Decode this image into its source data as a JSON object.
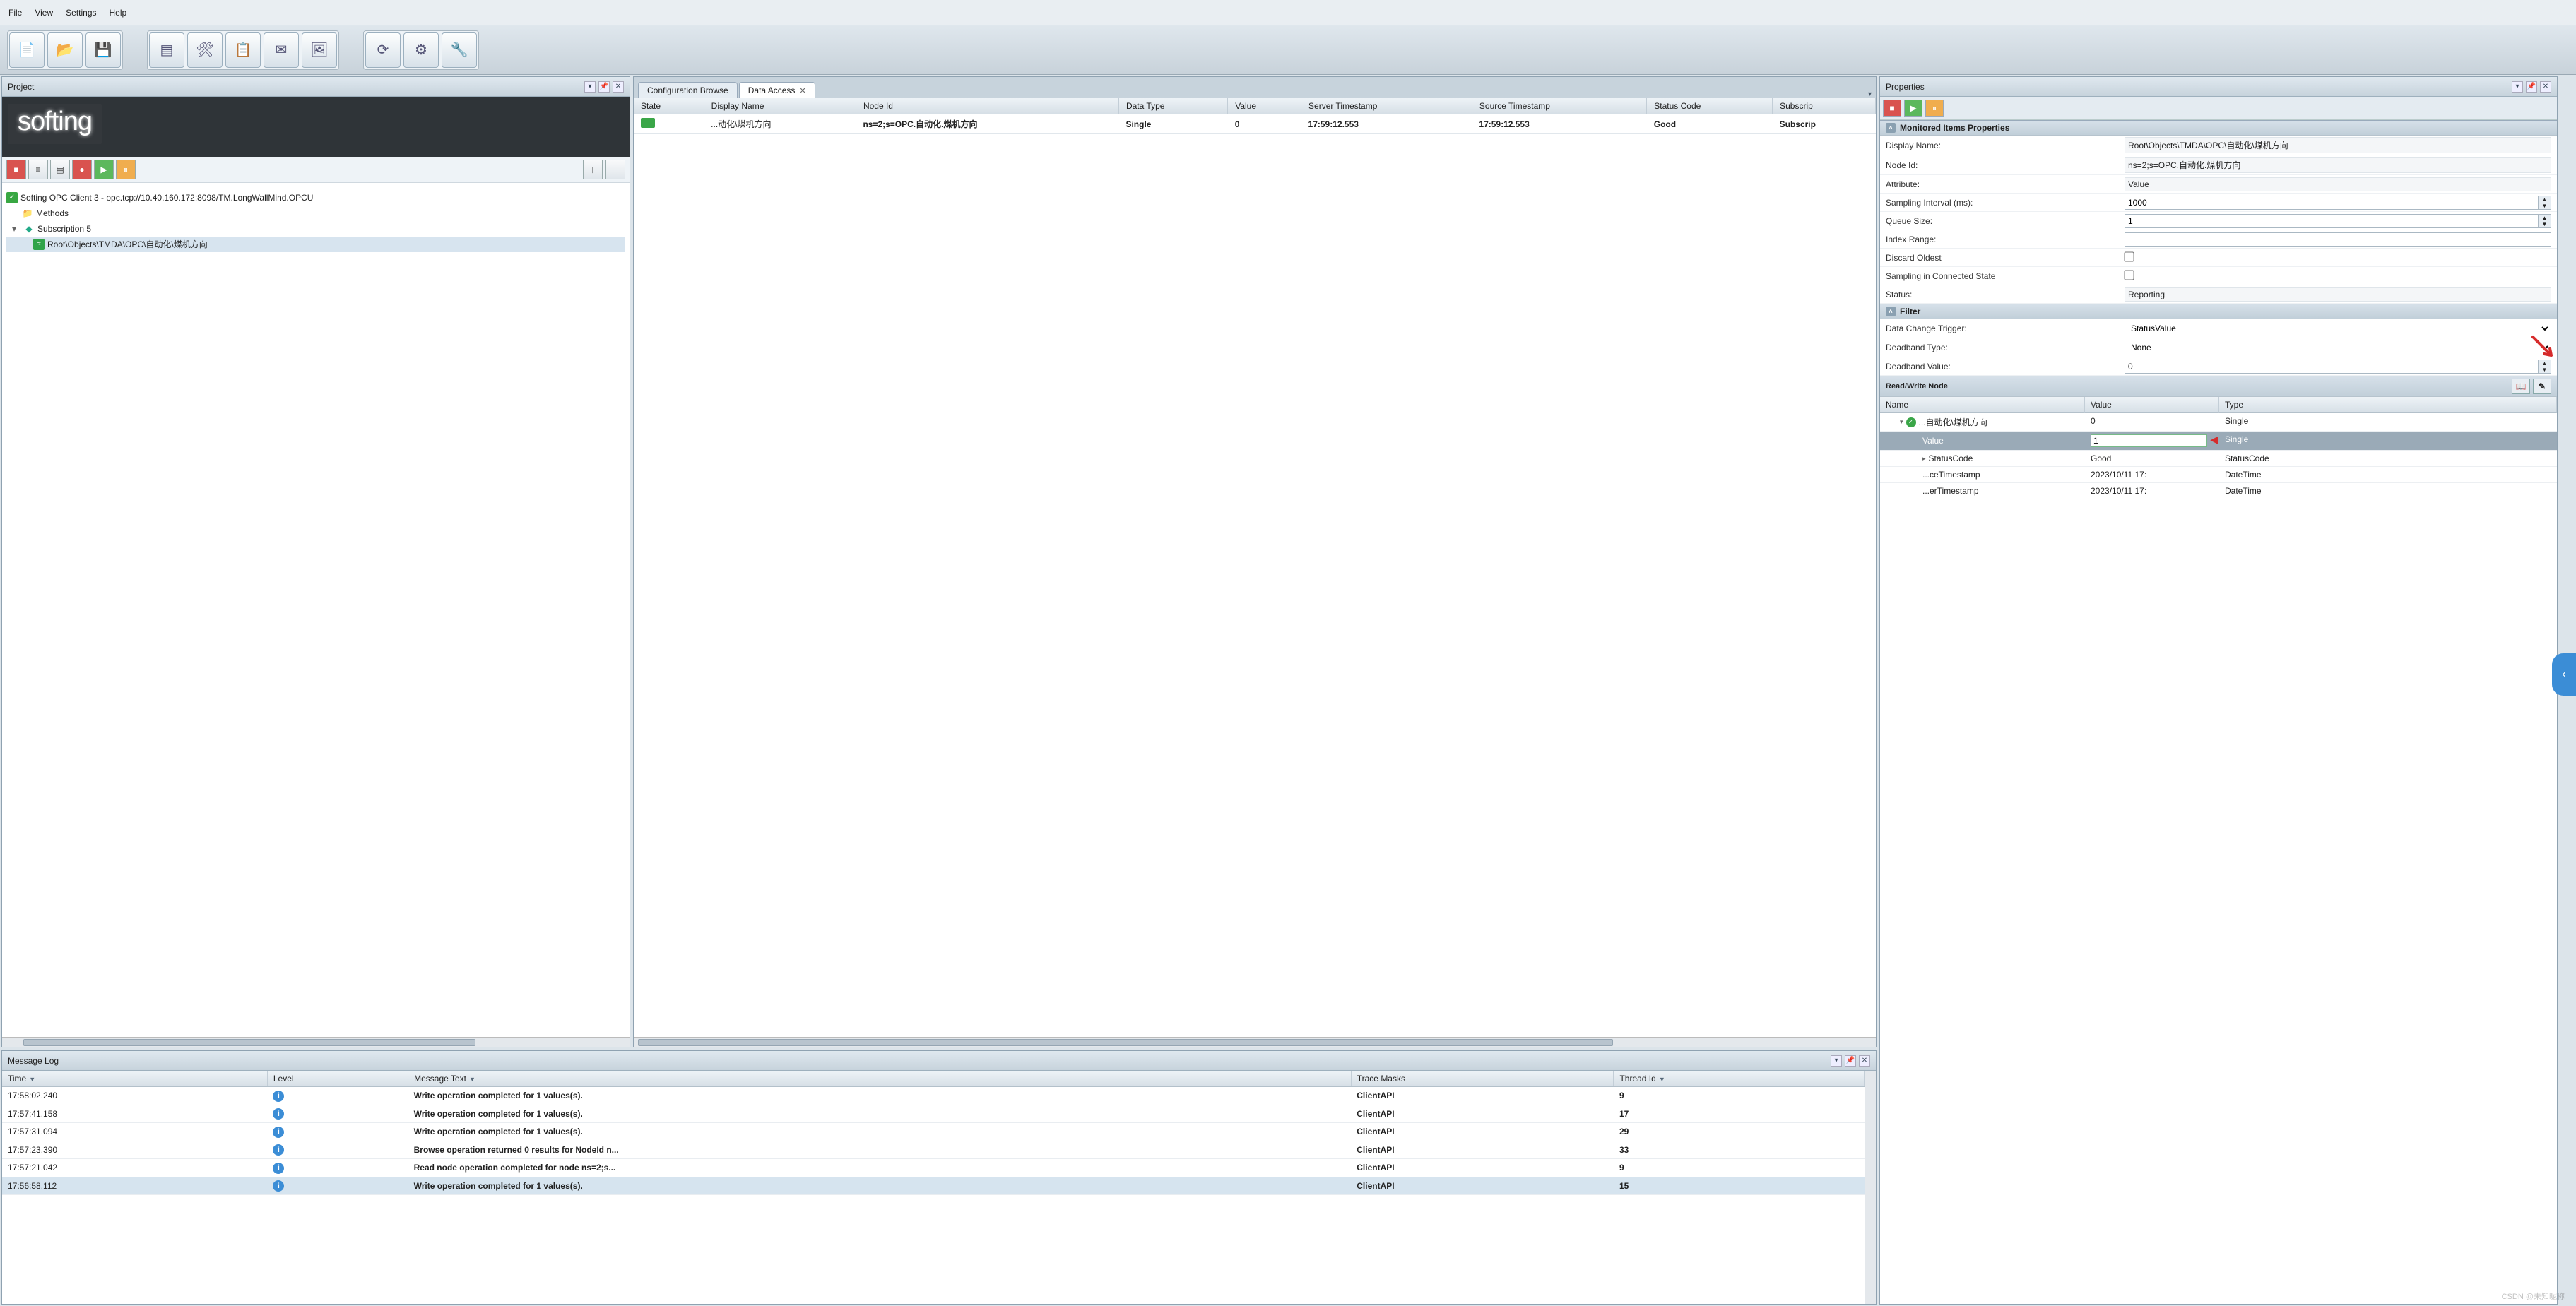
{
  "menu": {
    "file": "File",
    "view": "View",
    "settings": "Settings",
    "help": "Help"
  },
  "project": {
    "title": "Project",
    "logo": "softing",
    "root": "Softing OPC Client 3 - opc.tcp://10.40.160.172:8098/TM.LongWallMind.OPCU",
    "methods": "Methods",
    "subscription": "Subscription 5",
    "item": "Root\\Objects\\TMDA\\OPC\\自动化\\煤机方向"
  },
  "tabs": {
    "configBrowse": "Configuration Browse",
    "dataAccess": "Data Access"
  },
  "dataAccess": {
    "headers": {
      "state": "State",
      "displayName": "Display Name",
      "nodeId": "Node Id",
      "dataType": "Data Type",
      "value": "Value",
      "serverTs": "Server Timestamp",
      "sourceTs": "Source Timestamp",
      "statusCode": "Status Code",
      "subscrip": "Subscrip"
    },
    "row": {
      "displayName": "...动化\\煤机方向",
      "nodeId": "ns=2;s=OPC.自动化.煤机方向",
      "dataType": "Single",
      "value": "0",
      "serverTs": "17:59:12.553",
      "sourceTs": "17:59:12.553",
      "statusCode": "Good",
      "subscrip": "Subscrip"
    }
  },
  "props": {
    "title": "Properties",
    "sectionMonitored": "Monitored Items Properties",
    "displayName": {
      "label": "Display Name:",
      "value": "Root\\Objects\\TMDA\\OPC\\自动化\\煤机方向"
    },
    "nodeId": {
      "label": "Node Id:",
      "value": "ns=2;s=OPC.自动化.煤机方向"
    },
    "attribute": {
      "label": "Attribute:",
      "value": "Value"
    },
    "samplingInterval": {
      "label": "Sampling Interval (ms):",
      "value": "1000"
    },
    "queueSize": {
      "label": "Queue Size:",
      "value": "1"
    },
    "indexRange": {
      "label": "Index Range:",
      "value": ""
    },
    "discardOldest": {
      "label": "Discard Oldest",
      "checked": false
    },
    "samplingConnected": {
      "label": "Sampling in Connected State",
      "checked": false
    },
    "status": {
      "label": "Status:",
      "value": "Reporting"
    },
    "sectionFilter": "Filter",
    "dataChangeTrigger": {
      "label": "Data Change Trigger:",
      "value": "StatusValue"
    },
    "deadbandType": {
      "label": "Deadband Type:",
      "value": "None"
    },
    "deadbandValue": {
      "label": "Deadband Value:",
      "value": "0"
    },
    "sectionRWN": "Read/Write Node",
    "rwn": {
      "headers": {
        "name": "Name",
        "value": "Value",
        "type": "Type"
      },
      "rows": [
        {
          "name": "...自动化\\煤机方向",
          "value": "0",
          "type": "Single",
          "indent": 1,
          "ok": true,
          "exp": "▾"
        },
        {
          "name": "Value",
          "value": "1",
          "type": "Single",
          "indent": 2,
          "selected": true,
          "editable": true
        },
        {
          "name": "StatusCode",
          "value": "Good",
          "type": "StatusCode",
          "indent": 2,
          "exp": "▸"
        },
        {
          "name": "...ceTimestamp",
          "value": "2023/10/11 17:",
          "type": "DateTime",
          "indent": 2
        },
        {
          "name": "...erTimestamp",
          "value": "2023/10/11 17:",
          "type": "DateTime",
          "indent": 2
        }
      ]
    }
  },
  "log": {
    "title": "Message Log",
    "headers": {
      "time": "Time",
      "level": "Level",
      "message": "Message Text",
      "trace": "Trace Masks",
      "thread": "Thread Id"
    },
    "rows": [
      {
        "time": "17:58:02.240",
        "msg": "Write operation completed for 1 values(s).",
        "trace": "ClientAPI",
        "thread": "9"
      },
      {
        "time": "17:57:41.158",
        "msg": "Write operation completed for 1 values(s).",
        "trace": "ClientAPI",
        "thread": "17"
      },
      {
        "time": "17:57:31.094",
        "msg": "Write operation completed for 1 values(s).",
        "trace": "ClientAPI",
        "thread": "29"
      },
      {
        "time": "17:57:23.390",
        "msg": "Browse operation returned 0 results for NodeId n...",
        "trace": "ClientAPI",
        "thread": "33"
      },
      {
        "time": "17:57:21.042",
        "msg": "Read node operation completed for node ns=2;s...",
        "trace": "ClientAPI",
        "thread": "9"
      },
      {
        "time": "17:56:58.112",
        "msg": "Write operation completed for 1 values(s).",
        "trace": "ClientAPI",
        "thread": "15",
        "sel": true
      }
    ]
  },
  "watermark": "CSDN @未知昵称"
}
